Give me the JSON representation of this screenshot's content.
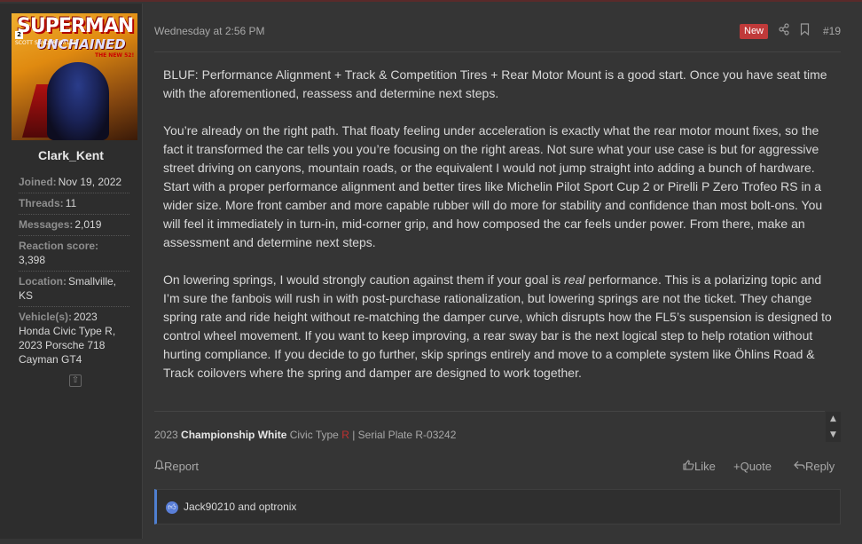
{
  "user": {
    "avatar_text": {
      "title": "SUPERMAN",
      "subtitle": "UNCHAINED",
      "tag": "THE NEW 52!",
      "issue": "2",
      "credits": "SCOTT SNYDER JIM LEE"
    },
    "username": "Clark_Kent",
    "stats": [
      {
        "key": "Joined:",
        "value": "Nov 19, 2022"
      },
      {
        "key": "Threads:",
        "value": "11"
      },
      {
        "key": "Messages:",
        "value": "2,019"
      },
      {
        "key": "Reaction score:",
        "value": "3,398"
      },
      {
        "key": "Location:",
        "value": "Smallville, KS"
      },
      {
        "key": "Vehicle(s):",
        "value": "2023 Honda Civic Type R, 2023 Porsche 718 Cayman GT4"
      }
    ],
    "scroll_icon": "arrow-up-icon"
  },
  "header": {
    "date": "Wednesday at 2:56 PM",
    "badge": "New",
    "share_icon": "share-icon",
    "bookmark_icon": "bookmark-icon",
    "post_number": "#19"
  },
  "body": {
    "p1": "BLUF: Performance Alignment + Track & Competition Tires + Rear Motor Mount is a good start. Once you have seat time with the aforementioned, reassess and determine next steps.",
    "p2": "You’re already on the right path. That floaty feeling under acceleration is exactly what the rear motor mount fixes, so the fact it transformed the car tells you you’re focusing on the right areas. Not sure what your use case is but for aggressive street driving on canyons, mountain roads, or the equivalent I would not jump straight into adding a bunch of hardware. Start with a proper performance alignment and better tires like Michelin Pilot Sport Cup 2 or Pirelli P Zero Trofeo RS in a wider size. More front camber and more capable rubber will do more for stability and confidence than most bolt-ons. You will feel it immediately in turn-in, mid-corner grip, and how composed the car feels under power. From there, make an assessment and determine next steps.",
    "p3_before": "On lowering springs, I would strongly caution against them if your goal is ",
    "p3_italic": "real",
    "p3_after": " performance. This is a polarizing topic and I’m sure the fanbois will rush in with post-purchase rationalization, but lowering springs are not the ticket. They change spring rate and ride height without re-matching the damper curve, which disrupts how the FL5’s suspension is designed to control wheel movement. If you want to keep improving, a rear sway bar is the next logical step to help rotation without hurting compliance. If you decide to go further, skip springs entirely and move to a complete system like Öhlins Road & Track coilovers where the spring and damper are designed to work together."
  },
  "signature": {
    "year": "2023",
    "color": "Championship White",
    "model": "Civic Type",
    "r": "R",
    "rest": "| Serial Plate R-03242"
  },
  "actions": {
    "report": "Report",
    "like": "Like",
    "quote": "+Quote",
    "reply": "Reply"
  },
  "reactions": {
    "icon": "thumbs-up-icon",
    "text": "Jack90210 and optronix"
  },
  "colors": {
    "accent": "#4f7fd0",
    "badge": "#c03a3a",
    "background": "#353535"
  }
}
